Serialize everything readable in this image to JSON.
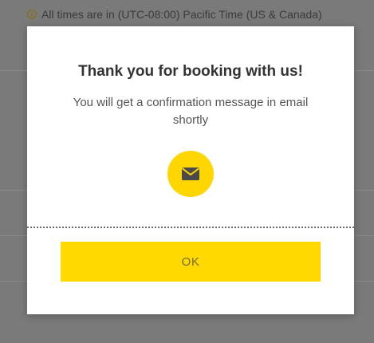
{
  "background": {
    "timezone_notice": "All times are in (UTC-08:00) Pacific Time (US & Canada)"
  },
  "dialog": {
    "title": "Thank you for booking with us!",
    "message": "You will get a confirmation message in email shortly",
    "icon": "envelope-icon",
    "ok_label": "OK"
  },
  "colors": {
    "accent": "#ffd600",
    "overlay": "#7a7a7a",
    "dialog_bg": "#ffffff"
  }
}
